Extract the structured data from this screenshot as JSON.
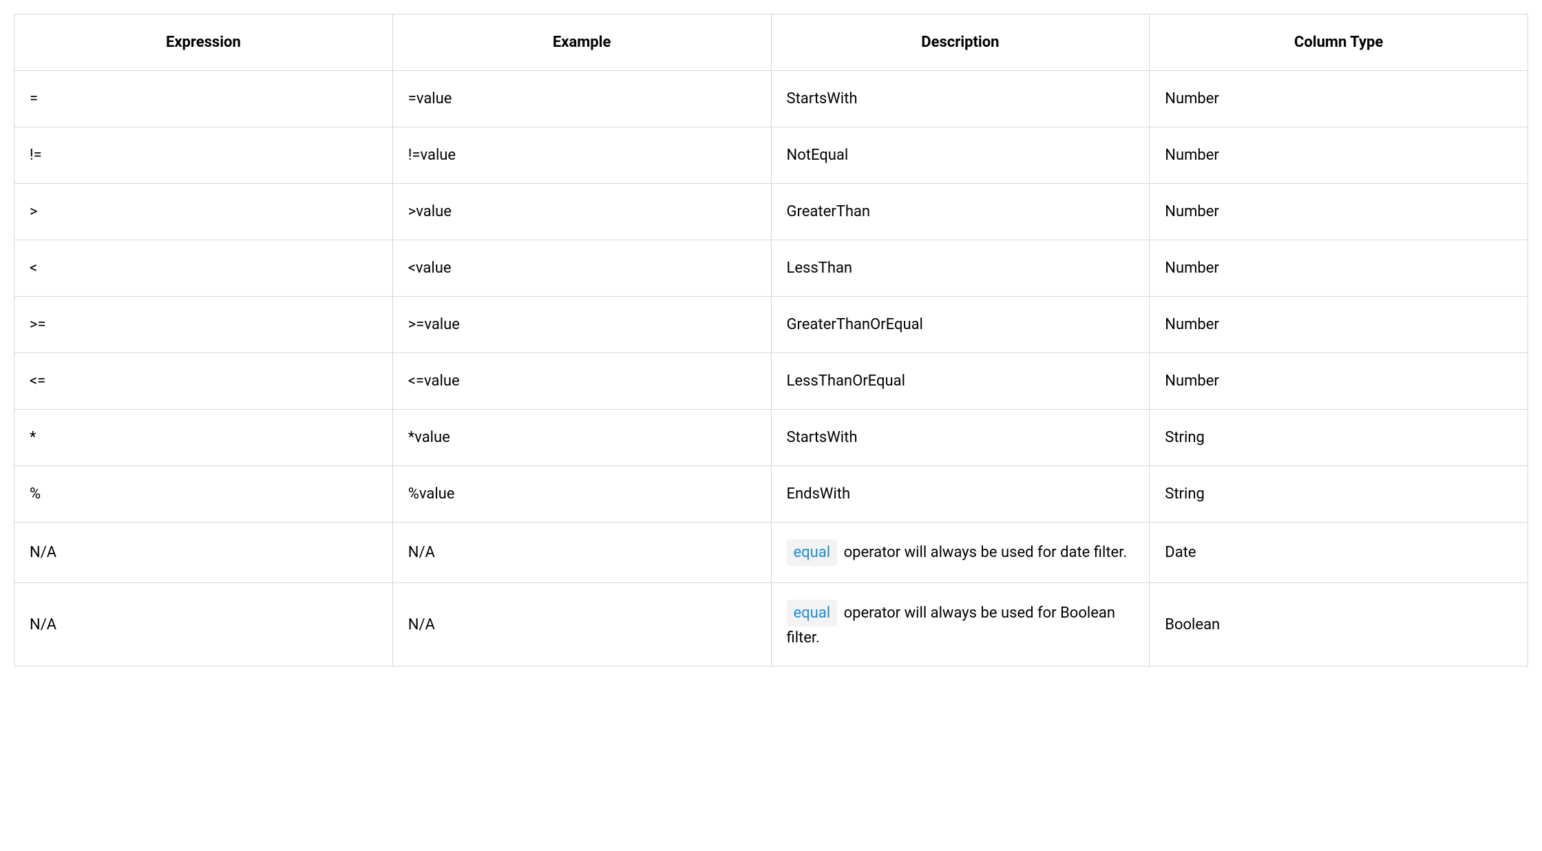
{
  "table": {
    "headers": [
      "Expression",
      "Example",
      "Description",
      "Column Type"
    ],
    "rows": [
      {
        "expression": "=",
        "example": "=value",
        "description_type": "plain",
        "description": "StartsWith",
        "column_type": "Number"
      },
      {
        "expression": "!=",
        "example": "!=value",
        "description_type": "plain",
        "description": "NotEqual",
        "column_type": "Number"
      },
      {
        "expression": ">",
        "example": ">value",
        "description_type": "plain",
        "description": "GreaterThan",
        "column_type": "Number"
      },
      {
        "expression": "<",
        "example": "<value",
        "description_type": "plain",
        "description": "LessThan",
        "column_type": "Number"
      },
      {
        "expression": ">=",
        "example": ">=value",
        "description_type": "plain",
        "description": "GreaterThanOrEqual",
        "column_type": "Number"
      },
      {
        "expression": "<=",
        "example": "<=value",
        "description_type": "plain",
        "description": "LessThanOrEqual",
        "column_type": "Number"
      },
      {
        "expression": "*",
        "example": "*value",
        "description_type": "plain",
        "description": "StartsWith",
        "column_type": "String"
      },
      {
        "expression": "%",
        "example": "%value",
        "description_type": "plain",
        "description": "EndsWith",
        "column_type": "String"
      },
      {
        "expression": "N/A",
        "example": "N/A",
        "description_type": "code",
        "code_text": "equal",
        "description": " operator will always be used for date filter.",
        "column_type": "Date"
      },
      {
        "expression": "N/A",
        "example": "N/A",
        "description_type": "code",
        "code_text": "equal",
        "description": " operator will always be used for Boolean filter.",
        "column_type": "Boolean"
      }
    ]
  }
}
